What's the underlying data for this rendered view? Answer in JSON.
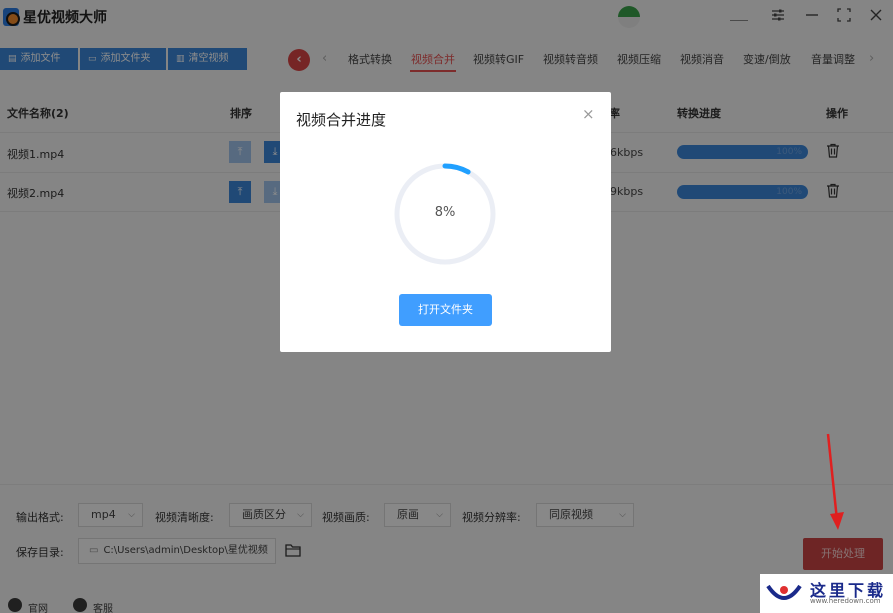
{
  "app": {
    "title": "星优视频大师"
  },
  "toolbar": {
    "add_file": "添加文件",
    "add_folder": "添加文件夹",
    "clear_videos": "清空视频"
  },
  "tabs": [
    {
      "label": "格式转换"
    },
    {
      "label": "视频合并"
    },
    {
      "label": "视频转GIF"
    },
    {
      "label": "视频转音频"
    },
    {
      "label": "视频压缩"
    },
    {
      "label": "视频消音"
    },
    {
      "label": "变速/倒放"
    },
    {
      "label": "音量调整"
    }
  ],
  "table": {
    "headers": {
      "name": "文件名称(2)",
      "sort": "排序",
      "bitrate": "率",
      "progress": "转换进度",
      "actions": "操作"
    },
    "rows": [
      {
        "name": "视频1.mp4",
        "bitrate": "6kbps",
        "progress_label": "100%",
        "progress": 1.0
      },
      {
        "name": "视频2.mp4",
        "bitrate": "9kbps",
        "progress_label": "100%",
        "progress": 1.0
      }
    ]
  },
  "settings": {
    "output_format_label": "输出格式:",
    "output_format_value": "mp4",
    "clarity_label": "视频清晰度:",
    "clarity_value": "画质区分",
    "quality_label": "视频画质:",
    "quality_value": "原画",
    "resolution_label": "视频分辨率:",
    "resolution_value": "同原视频",
    "save_dir_label": "保存目录:",
    "save_dir_value": "C:\\Users\\admin\\Desktop\\星优视频",
    "start_button": "开始处理"
  },
  "footer": {
    "website": "官网",
    "service": "客服"
  },
  "modal": {
    "title": "视频合并进度",
    "percent_label": "8%",
    "percent": 0.08,
    "open_folder": "打开文件夹"
  },
  "watermark": {
    "text": "这里下载",
    "url": "www.heredown.com"
  },
  "colors": {
    "primary": "#3b86d8",
    "accent": "#e35050",
    "start": "#c84444",
    "modal_button": "#409eff"
  }
}
